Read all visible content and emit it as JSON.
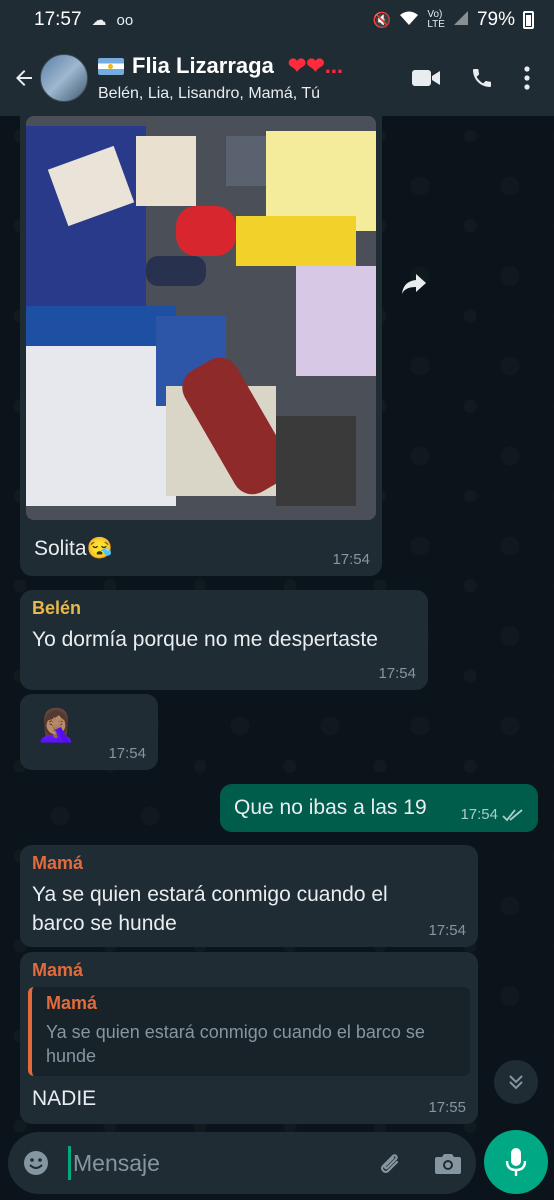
{
  "status_bar": {
    "time": "17:57",
    "battery": "79%"
  },
  "header": {
    "title": "Flia Lizarraga",
    "hearts": "❤❤...",
    "members": "Belén, Lia, Lisandro, Mamá, Tú"
  },
  "messages": [
    {
      "type": "image",
      "caption": "Solita",
      "caption_emoji": "😪",
      "time": "17:54"
    },
    {
      "sender": "Belén",
      "sender_color": "#e8b84a",
      "text": "Yo dormía porque no me despertaste",
      "time": "17:54"
    },
    {
      "type": "emoji",
      "emoji": "🤦🏽‍♀️",
      "time": "17:54"
    },
    {
      "direction": "out",
      "text": "Que no ibas a las 19",
      "time": "17:54",
      "status": "read"
    },
    {
      "sender": "Mamá",
      "sender_color": "#e26a3b",
      "text": "Ya se quien estará conmigo cuando el barco se hunde",
      "time": "17:54"
    },
    {
      "sender": "Mamá",
      "sender_color": "#e26a3b",
      "quote": {
        "name": "Mamá",
        "text": "Ya se quien estará conmigo cuando el barco se hunde"
      },
      "text": "NADIE",
      "time": "17:55"
    }
  ],
  "composer": {
    "placeholder": "Mensaje"
  },
  "icons": {
    "back": "arrow-left-icon",
    "video": "video-camera-icon",
    "call": "phone-icon",
    "menu": "more-vertical-icon",
    "forward": "forward-icon",
    "emoji": "smiley-icon",
    "attach": "paperclip-icon",
    "camera": "camera-icon",
    "mic": "microphone-icon",
    "scroll": "double-chevron-down-icon",
    "read": "double-check-icon"
  }
}
